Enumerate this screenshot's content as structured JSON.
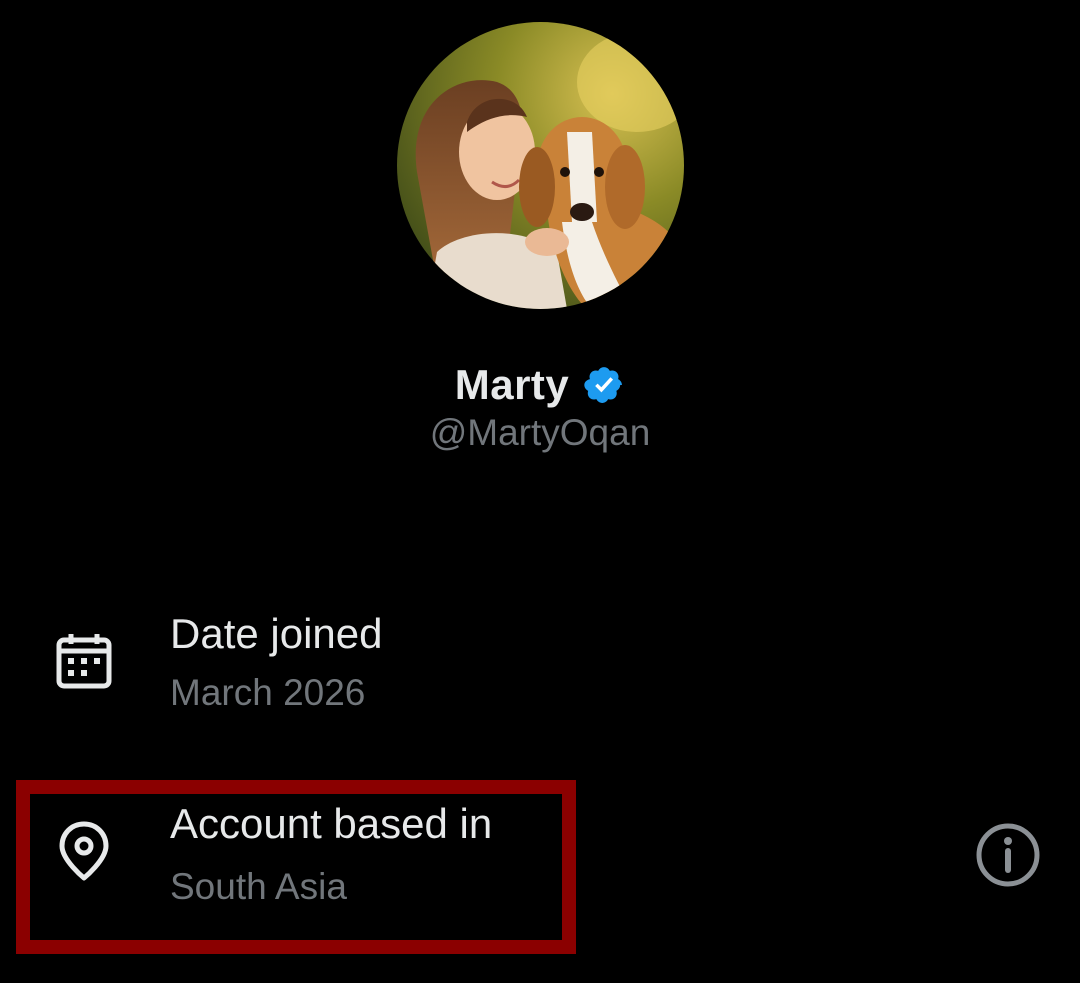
{
  "profile": {
    "display_name": "Marty",
    "handle": "@MartyOqan",
    "verified": true,
    "verified_badge_color": "#1d9bf0",
    "avatar_description_icon": "profile-photo"
  },
  "details": [
    {
      "icon": "calendar-icon",
      "title": "Date joined",
      "value": "March 2026"
    },
    {
      "icon": "location-pin-icon",
      "title": "Account based in",
      "value": "South Asia",
      "info_icon": "info-icon"
    }
  ],
  "colors": {
    "background": "#000000",
    "primary_text": "#e7e9ea",
    "secondary_text": "#71767b",
    "highlight_border": "#8b0000"
  }
}
